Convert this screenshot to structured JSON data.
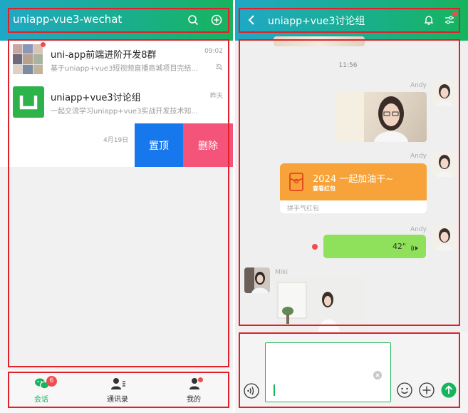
{
  "colors": {
    "header_gradient_start": "#1fa8c7",
    "header_gradient_end": "#16b45d",
    "pin_button": "#1778ee",
    "delete_button": "#f4547a",
    "red_packet": "#f7a33a",
    "voice_bubble": "#8fe05a",
    "badge": "#f04e4e",
    "active_tab": "#16b45d",
    "annotation_border": "#e0202a"
  },
  "left": {
    "header": {
      "title": "uniapp-vue3-wechat"
    },
    "chats": [
      {
        "name": "uni-app前端进阶开发8群",
        "preview": "基于uniapp+vue3短视频直播商城项目完结...",
        "time": "09:02",
        "muted": true,
        "unread_dot": true
      },
      {
        "name": "uniapp+vue3讨论组",
        "preview": "一起交流学习uniapp+vue3实战开发技术知...",
        "time": "昨天"
      }
    ],
    "swipe_row": {
      "time": "4月19日",
      "pin_label": "置顶",
      "delete_label": "删除"
    },
    "tabbar": {
      "tabs": [
        {
          "label": "会话",
          "badge": "6",
          "active": true
        },
        {
          "label": "通讯录"
        },
        {
          "label": "我的",
          "dot": true
        }
      ]
    }
  },
  "right": {
    "header": {
      "title": "uniapp+vue3讨论组"
    },
    "messages": {
      "timestamp": "11:56",
      "sender1": "Andy",
      "sender2": "Andy",
      "sender3": "Andy",
      "sender4": "Miki",
      "red_packet": {
        "title": "2024 一起加油干~",
        "subtitle": "查看红包",
        "footer": "拼手气红包"
      },
      "voice": {
        "duration": "42\""
      }
    }
  }
}
